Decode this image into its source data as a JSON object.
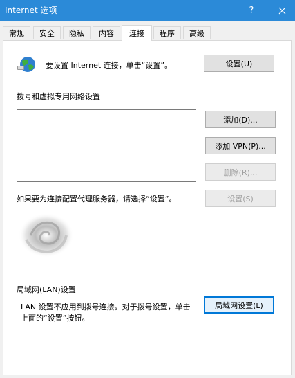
{
  "window": {
    "title": "Internet 选项",
    "help_glyph": "?",
    "close_glyph": "✕"
  },
  "tabs": [
    {
      "label": "常规"
    },
    {
      "label": "安全"
    },
    {
      "label": "隐私"
    },
    {
      "label": "内容"
    },
    {
      "label": "连接",
      "active": true
    },
    {
      "label": "程序"
    },
    {
      "label": "高级"
    }
  ],
  "setup": {
    "text": "要设置 Internet 连接，单击“设置”。",
    "button": "设置(U)"
  },
  "dialup": {
    "heading": "拨号和虚拟专用网络设置",
    "add_button": "添加(D)...",
    "add_vpn_button": "添加 VPN(P)...",
    "delete_button": "删除(R)...",
    "proxy_text": "如果要为连接配置代理服务器，请选择“设置”。",
    "settings_button": "设置(S)"
  },
  "lan": {
    "heading": "局域网(LAN)设置",
    "text_line1": "LAN 设置不应用到拨号连接。对于拨号设置，单击",
    "text_line2": "上面的“设置”按钮。",
    "button": "局域网设置(L)"
  },
  "colors": {
    "titlebar": "#2b8ad8",
    "focus": "#0078d7"
  }
}
